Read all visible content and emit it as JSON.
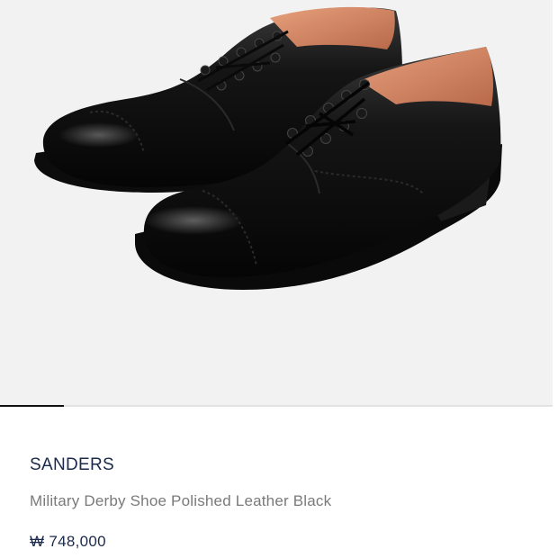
{
  "product": {
    "brand": "SANDERS",
    "name": "Military Derby Shoe Polished Leather Black",
    "price": "₩ 748,000"
  },
  "carousel": {
    "progress": 0.115
  },
  "colors": {
    "image_background": "#f2f2f2",
    "brand_text": "#1b2a4a",
    "name_text": "#7a7a7a",
    "indicator_active": "#111111",
    "indicator_track": "#e2e2e2"
  }
}
